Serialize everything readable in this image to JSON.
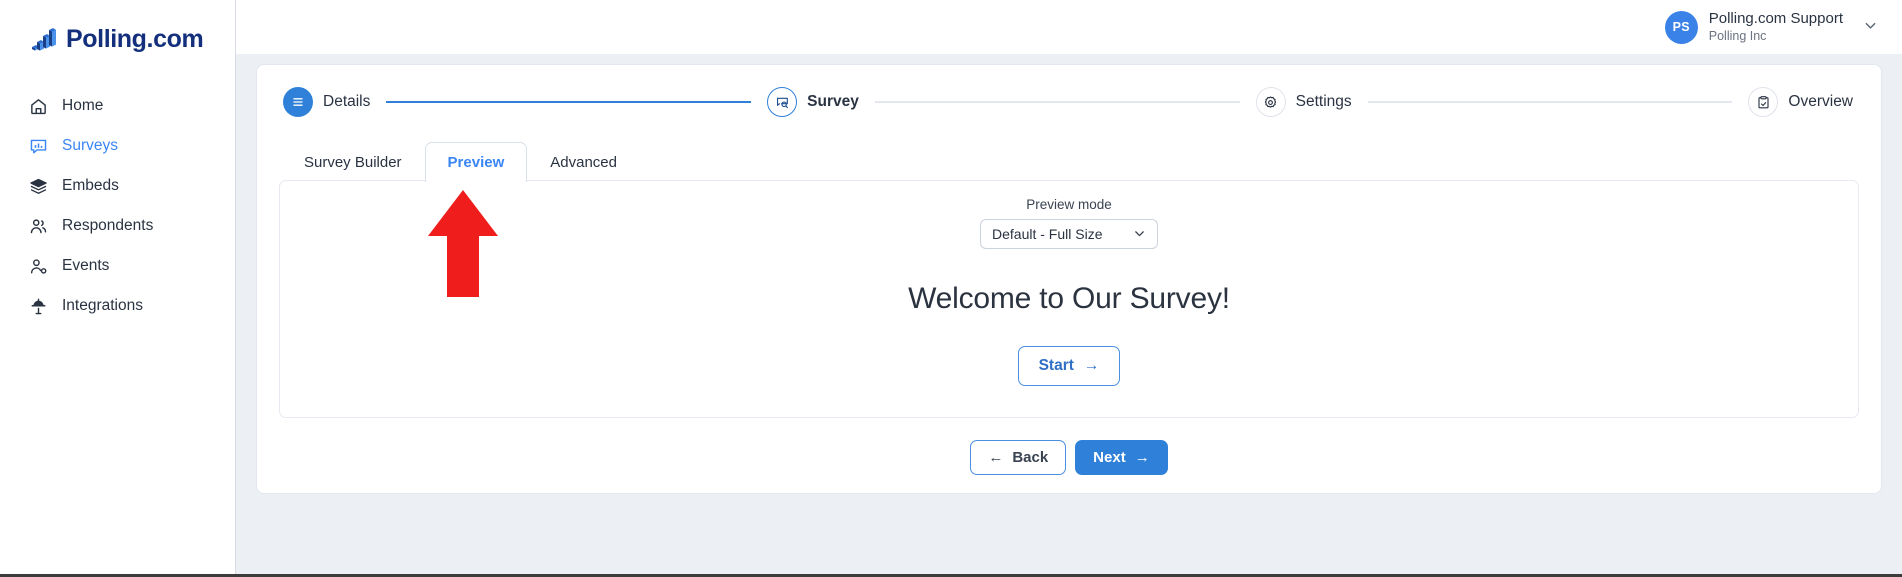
{
  "brand": {
    "name": "Polling.com",
    "logo_icon": "bar-chart-3d-icon"
  },
  "sidebar": {
    "items": [
      {
        "label": "Home",
        "icon": "home-icon",
        "active": false
      },
      {
        "label": "Surveys",
        "icon": "survey-chart-icon",
        "active": true
      },
      {
        "label": "Embeds",
        "icon": "layers-icon",
        "active": false
      },
      {
        "label": "Respondents",
        "icon": "users-icon",
        "active": false
      },
      {
        "label": "Events",
        "icon": "user-gear-icon",
        "active": false
      },
      {
        "label": "Integrations",
        "icon": "plug-icon",
        "active": false
      }
    ]
  },
  "topbar": {
    "avatar_initials": "PS",
    "user_name": "Polling.com Support",
    "organization": "Polling Inc",
    "chevron_icon": "chevron-down-icon"
  },
  "stepper": {
    "steps": [
      {
        "label": "Details",
        "icon": "list-icon",
        "state": "done"
      },
      {
        "label": "Survey",
        "icon": "survey-search-icon",
        "state": "current"
      },
      {
        "label": "Settings",
        "icon": "gear-icon",
        "state": "todo"
      },
      {
        "label": "Overview",
        "icon": "clipboard-check-icon",
        "state": "todo"
      }
    ]
  },
  "tabs": [
    {
      "label": "Survey Builder",
      "active": false
    },
    {
      "label": "Preview",
      "active": true
    },
    {
      "label": "Advanced",
      "active": false
    }
  ],
  "preview": {
    "mode_label": "Preview mode",
    "mode_value": "Default - Full Size",
    "mode_options": [
      "Default - Full Size"
    ],
    "welcome_title": "Welcome to Our Survey!",
    "start_label": "Start",
    "start_arrow": "→"
  },
  "footer_buttons": {
    "back_label": "Back",
    "back_arrow": "←",
    "next_label": "Next",
    "next_arrow": "→"
  },
  "annotation": {
    "type": "red-arrow-up",
    "color": "#f01d1d",
    "points_at": "Preview"
  },
  "colors": {
    "accent_blue": "#2f80d8",
    "link_blue": "#3b86f5",
    "brand_navy": "#14307d",
    "page_bg": "#eceff4",
    "annotation_red": "#f01d1d"
  }
}
